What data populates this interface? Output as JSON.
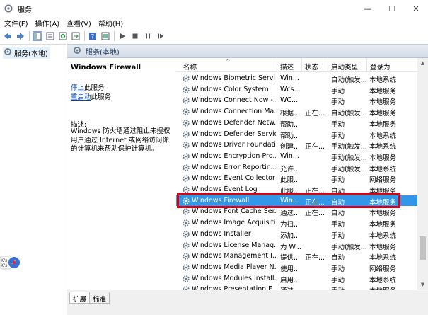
{
  "window": {
    "title": "服务",
    "icon": "gear-icon",
    "controls": {
      "minimize": "—",
      "maximize": "☐",
      "close": "✕"
    }
  },
  "menubar": {
    "items": [
      "文件(F)",
      "操作(A)",
      "查看(V)",
      "帮助(H)"
    ]
  },
  "toolbar": {
    "icons": [
      "back-arrow-icon",
      "forward-arrow-icon",
      "console-tree-icon",
      "properties-icon",
      "refresh-icon",
      "export-list-icon",
      "help-icon",
      "mmc-icon",
      "start-icon",
      "stop-icon",
      "pause-icon",
      "restart-icon"
    ]
  },
  "tree": {
    "item_label": "服务(本地)"
  },
  "pane": {
    "header_label": "服务(本地)"
  },
  "description": {
    "service_title": "Windows Firewall",
    "stop_link": "停止",
    "stop_suffix": "此服务",
    "restart_link": "重启动",
    "restart_suffix": "此服务",
    "desc_label": "描述:",
    "desc_text": "Windows 防火墙通过阻止未授权用户通过 Internet 或网络访问你的计算机来帮助保护计算机。"
  },
  "list": {
    "columns": {
      "name": "名称",
      "desc": "描述",
      "status": "状态",
      "startup": "启动类型",
      "logon": "登录为"
    },
    "rows": [
      {
        "name": "Windows Biometric Servi...",
        "desc": "Win...",
        "status": "",
        "startup": "自动(触发...",
        "logon": "本地系统"
      },
      {
        "name": "Windows Color System",
        "desc": "Wcs...",
        "status": "",
        "startup": "手动",
        "logon": "本地服务"
      },
      {
        "name": "Windows Connect Now -...",
        "desc": "WC...",
        "status": "",
        "startup": "手动",
        "logon": "本地服务"
      },
      {
        "name": "Windows Connection Ma...",
        "desc": "根据...",
        "status": "正在...",
        "startup": "自动(触发...",
        "logon": "本地服务"
      },
      {
        "name": "Windows Defender Netw...",
        "desc": "帮助...",
        "status": "",
        "startup": "手动",
        "logon": "本地服务"
      },
      {
        "name": "Windows Defender Service",
        "desc": "帮助...",
        "status": "",
        "startup": "手动",
        "logon": "本地系统"
      },
      {
        "name": "Windows Driver Foundati...",
        "desc": "创建...",
        "status": "正在...",
        "startup": "手动(触发...",
        "logon": "本地系统"
      },
      {
        "name": "Windows Encryption Pro...",
        "desc": "Win...",
        "status": "",
        "startup": "手动(触发...",
        "logon": "本地服务"
      },
      {
        "name": "Windows Error Reportin...",
        "desc": "允许...",
        "status": "",
        "startup": "手动(触发...",
        "logon": "本地系统"
      },
      {
        "name": "Windows Event Collector",
        "desc": "此服...",
        "status": "",
        "startup": "手动",
        "logon": "网络服务"
      },
      {
        "name": "Windows Event Log",
        "desc": "此服...",
        "status": "正在...",
        "startup": "自动",
        "logon": "本地服务"
      },
      {
        "name": "Windows Firewall",
        "desc": "Win...",
        "status": "正在...",
        "startup": "自动",
        "logon": "本地服务"
      },
      {
        "name": "Windows Font Cache Ser...",
        "desc": "通过...",
        "status": "正在...",
        "startup": "自动",
        "logon": "本地服务"
      },
      {
        "name": "Windows Image Acquisiti...",
        "desc": "为扫...",
        "status": "",
        "startup": "手动",
        "logon": "本地服务"
      },
      {
        "name": "Windows Installer",
        "desc": "添加...",
        "status": "",
        "startup": "手动",
        "logon": "本地系统"
      },
      {
        "name": "Windows License Manag...",
        "desc": "为 W...",
        "status": "",
        "startup": "手动(触发...",
        "logon": "本地服务"
      },
      {
        "name": "Windows Management I...",
        "desc": "提供...",
        "status": "正在...",
        "startup": "自动",
        "logon": "本地系统"
      },
      {
        "name": "Windows Media Player N...",
        "desc": "使用...",
        "status": "",
        "startup": "手动",
        "logon": "网络服务"
      },
      {
        "name": "Windows Modules Install...",
        "desc": "启用...",
        "status": "",
        "startup": "手动",
        "logon": "本地系统"
      },
      {
        "name": "Windows Presentation F...",
        "desc": "通过...",
        "status": "",
        "startup": "手动",
        "logon": "本地服务"
      }
    ],
    "selected_index": 11
  },
  "tabs": {
    "extended": "扩展",
    "standard": "标准"
  },
  "colors": {
    "selection": "#3297e8",
    "highlight_box": "#d7001a",
    "link": "#0645ad"
  }
}
